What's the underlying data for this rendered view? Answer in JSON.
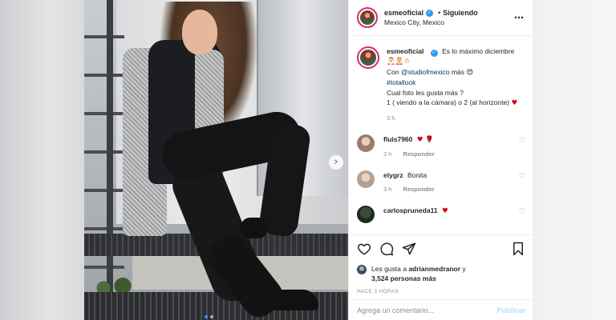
{
  "header": {
    "username": "esmeoficial",
    "separator": "•",
    "follow_label": "Siguiendo",
    "location": "Mexico City, Mexico",
    "more_icon": "⋯"
  },
  "caption": {
    "username": "esmeoficial",
    "line1": "Es lo máximo diciembre",
    "line1_emoji": "🎅🤶☃",
    "with_prefix": "Con",
    "mention": "@studiofmexico",
    "with_suffix": "más",
    "with_emoji": "😍",
    "hashtag": "#totallook",
    "question": "Cual foto les gusta más ?",
    "options": "1 ( viendo a la cámara) o 2 (al horizonte)",
    "options_emoji": "♥",
    "time": "3 h"
  },
  "comments": [
    {
      "username": "fluis7960",
      "text": "",
      "emoji": "♥ 🌹",
      "time": "3 h",
      "reply": "Responder"
    },
    {
      "username": "elygrz",
      "text": "Bonita",
      "emoji": "",
      "time": "3 h",
      "reply": "Responder"
    },
    {
      "username": "carlospruneda11",
      "text": "",
      "emoji": "♥",
      "time": "",
      "reply": ""
    }
  ],
  "likes": {
    "prefix": "Les gusta a",
    "user": "adrianmedranor",
    "joiner": "y",
    "count": "3,524 personas más"
  },
  "post_time": "HACE 3 HORAS",
  "comment_box": {
    "placeholder": "Agrega un comentario...",
    "post_label": "Publicar"
  },
  "photo": {
    "next_glyph": "›",
    "slide_count": 2,
    "active_slide": 1
  },
  "icons": {
    "like": "heart-icon",
    "comment": "comment-icon",
    "share": "share-icon",
    "save": "bookmark-icon"
  },
  "colors": {
    "verified": "#3897f0",
    "link": "#00376b",
    "heart": "#d0021b",
    "post_button_disabled": "#b2dffc",
    "muted": "#8e8e8e"
  }
}
